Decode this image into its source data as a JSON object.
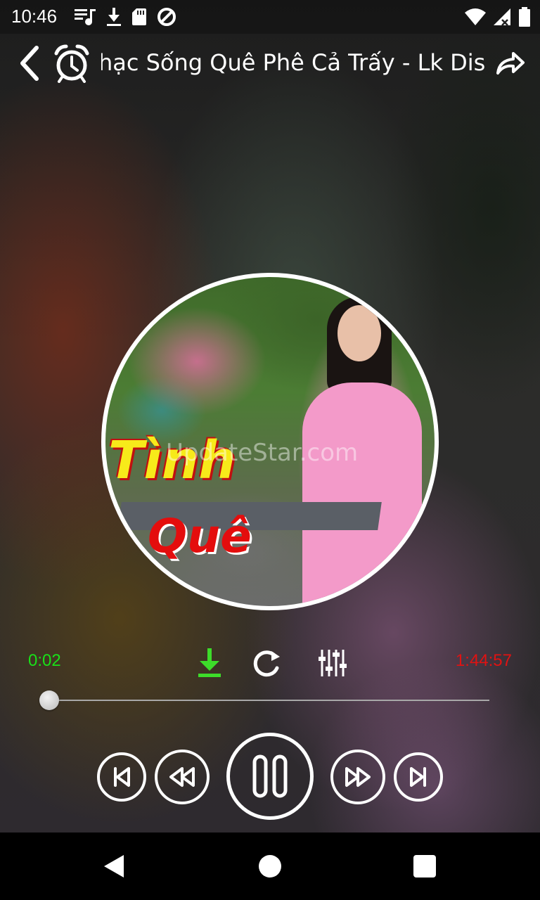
{
  "status_bar": {
    "time": "10:46",
    "left_icons": [
      "music-playlist-icon",
      "download-icon",
      "sd-card-icon",
      "data-saver-icon"
    ],
    "right_icons": [
      "wifi-icon",
      "signal-icon",
      "battery-icon"
    ]
  },
  "header": {
    "title": "Nhạc Sống Quê Phê Cả Trấy - Lk Disco Thộ",
    "icons": {
      "back": "chevron-left-icon",
      "alarm": "alarm-clock-icon",
      "share": "share-icon"
    }
  },
  "album_art": {
    "line1": "Tình",
    "line2": "Quê",
    "watermark": "UpdateStar.com"
  },
  "player": {
    "elapsed": "0:02",
    "total": "1:44:57",
    "progress_fraction": 0.0,
    "elapsed_color": "#19e019",
    "total_color": "#e01212",
    "download_icon_color": "#3ddc2a",
    "icons": {
      "download": "download-icon",
      "repeat": "repeat-icon",
      "equalizer": "equalizer-icon",
      "prev": "skip-previous-icon",
      "rewind": "rewind-icon",
      "play_pause": "pause-icon",
      "fast_forward": "fast-forward-icon",
      "next": "skip-next-icon"
    }
  },
  "nav_bar": {
    "icons": [
      "nav-back-icon",
      "nav-home-icon",
      "nav-recents-icon"
    ]
  }
}
